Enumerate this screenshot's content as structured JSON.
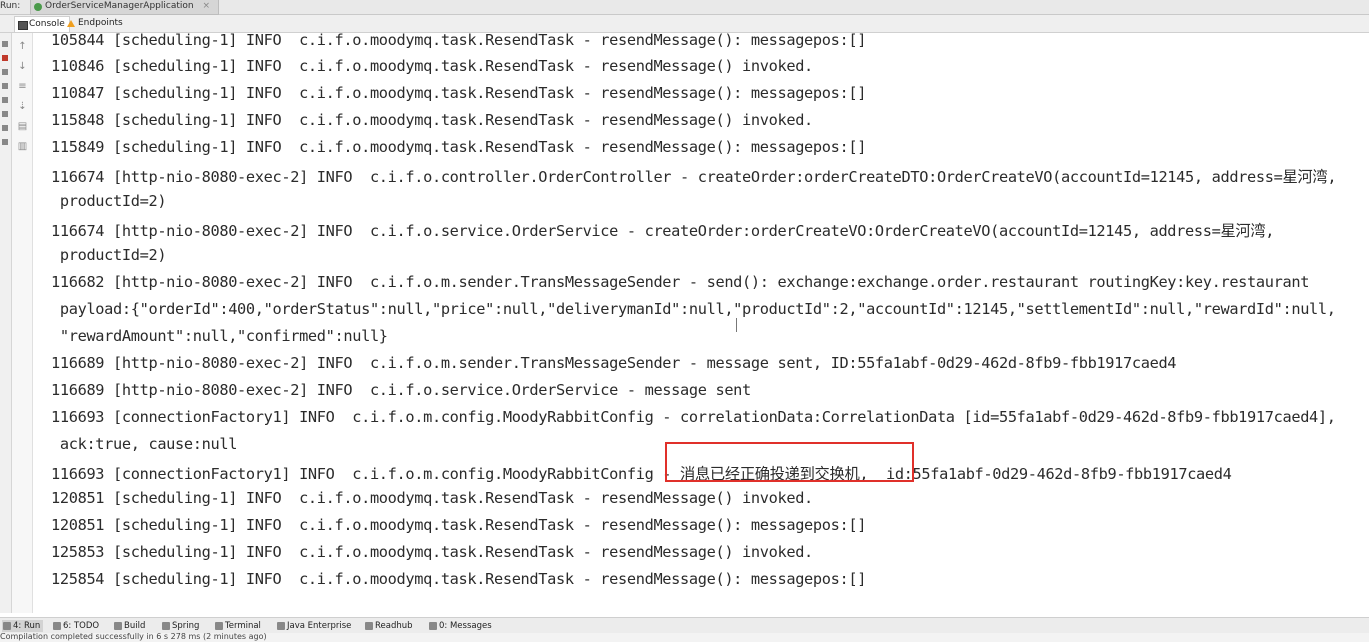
{
  "window": {
    "run_label": "Run:",
    "app_tab": "OrderServiceManagerApplication",
    "app_tab_close": "×"
  },
  "tabs": [
    {
      "label": "Console"
    },
    {
      "label": "Endpoints"
    }
  ],
  "console_lines": [
    "105844 [scheduling-1] INFO  c.i.f.o.moodymq.task.ResendTask - resendMessage(): messagepos:[]",
    "110846 [scheduling-1] INFO  c.i.f.o.moodymq.task.ResendTask - resendMessage() invoked.",
    "110847 [scheduling-1] INFO  c.i.f.o.moodymq.task.ResendTask - resendMessage(): messagepos:[]",
    "115848 [scheduling-1] INFO  c.i.f.o.moodymq.task.ResendTask - resendMessage() invoked.",
    "115849 [scheduling-1] INFO  c.i.f.o.moodymq.task.ResendTask - resendMessage(): messagepos:[]",
    "116674 [http-nio-8080-exec-2] INFO  c.i.f.o.controller.OrderController - createOrder:orderCreateDTO:OrderCreateVO(accountId=12145, address=星河湾,",
    " productId=2)",
    "116674 [http-nio-8080-exec-2] INFO  c.i.f.o.service.OrderService - createOrder:orderCreateVO:OrderCreateVO(accountId=12145, address=星河湾,",
    " productId=2)",
    "116682 [http-nio-8080-exec-2] INFO  c.i.f.o.m.sender.TransMessageSender - send(): exchange:exchange.order.restaurant routingKey:key.restaurant",
    " payload:{\"orderId\":400,\"orderStatus\":null,\"price\":null,\"deliverymanId\":null,\"productId\":2,\"accountId\":12145,\"settlementId\":null,\"rewardId\":null,",
    " \"rewardAmount\":null,\"confirmed\":null}",
    "116689 [http-nio-8080-exec-2] INFO  c.i.f.o.m.sender.TransMessageSender - message sent, ID:55fa1abf-0d29-462d-8fb9-fbb1917caed4",
    "116689 [http-nio-8080-exec-2] INFO  c.i.f.o.service.OrderService - message sent",
    "116693 [connectionFactory1] INFO  c.i.f.o.m.config.MoodyRabbitConfig - correlationData:CorrelationData [id=55fa1abf-0d29-462d-8fb9-fbb1917caed4],",
    " ack:true, cause:null",
    "116693 [connectionFactory1] INFO  c.i.f.o.m.config.MoodyRabbitConfig - 消息已经正确投递到交换机,  id:55fa1abf-0d29-462d-8fb9-fbb1917caed4",
    "120851 [scheduling-1] INFO  c.i.f.o.moodymq.task.ResendTask - resendMessage() invoked.",
    "120851 [scheduling-1] INFO  c.i.f.o.moodymq.task.ResendTask - resendMessage(): messagepos:[]",
    "125853 [scheduling-1] INFO  c.i.f.o.moodymq.task.ResendTask - resendMessage() invoked.",
    "125854 [scheduling-1] INFO  c.i.f.o.moodymq.task.ResendTask - resendMessage(): messagepos:[]"
  ],
  "bottom_tabs": [
    {
      "label": "4: Run"
    },
    {
      "label": "6: TODO"
    },
    {
      "label": "Build"
    },
    {
      "label": "Spring"
    },
    {
      "label": "Terminal"
    },
    {
      "label": "Java Enterprise"
    },
    {
      "label": "Readhub"
    },
    {
      "label": "0: Messages"
    }
  ],
  "status_text": "Compilation completed successfully in 6 s 278 ms (2 minutes ago)"
}
